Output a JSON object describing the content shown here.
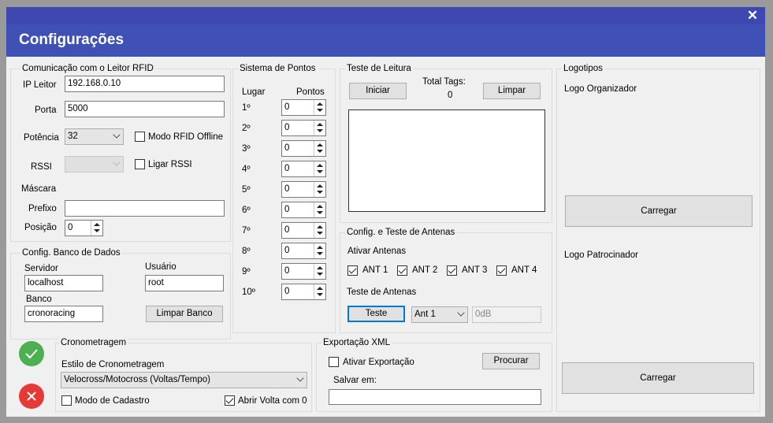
{
  "window": {
    "close_glyph": "✕",
    "title": "Configurações"
  },
  "rfid": {
    "title": "Comunicação com o Leitor RFID",
    "ip_label": "IP Leitor",
    "ip_value": "192.168.0.10",
    "porta_label": "Porta",
    "porta_value": "5000",
    "potencia_label": "Potência",
    "potencia_value": "32",
    "offline_label": "Modo RFID Offline",
    "rssi_label": "RSSI",
    "ligar_rssi_label": "Ligar RSSI",
    "mascara_label": "Máscara",
    "prefixo_label": "Prefixo",
    "prefixo_value": "",
    "posicao_label": "Posição",
    "posicao_value": "0"
  },
  "banco": {
    "title": "Config. Banco de Dados",
    "servidor_label": "Servidor",
    "servidor_value": "localhost",
    "usuario_label": "Usuário",
    "usuario_value": "root",
    "banco_label": "Banco",
    "banco_value": "cronoracing",
    "limpar_label": "Limpar Banco"
  },
  "pontos": {
    "title": "Sistema de Pontos",
    "lugar_header": "Lugar",
    "pontos_header": "Pontos",
    "rows": [
      {
        "place": "1º",
        "value": "0"
      },
      {
        "place": "2º",
        "value": "0"
      },
      {
        "place": "3º",
        "value": "0"
      },
      {
        "place": "4º",
        "value": "0"
      },
      {
        "place": "5º",
        "value": "0"
      },
      {
        "place": "6º",
        "value": "0"
      },
      {
        "place": "7º",
        "value": "0"
      },
      {
        "place": "8º",
        "value": "0"
      },
      {
        "place": "9º",
        "value": "0"
      },
      {
        "place": "10º",
        "value": "0"
      }
    ]
  },
  "leitura": {
    "title": "Teste de Leitura",
    "iniciar_label": "Iniciar",
    "total_tags_label": "Total Tags:",
    "total_tags_value": "0",
    "limpar_label": "Limpar"
  },
  "antenas": {
    "title": "Config. e Teste de Antenas",
    "ativar_label": "Ativar Antenas",
    "items": [
      {
        "label": "ANT 1",
        "checked": true
      },
      {
        "label": "ANT 2",
        "checked": true
      },
      {
        "label": "ANT 3",
        "checked": true
      },
      {
        "label": "ANT 4",
        "checked": true
      }
    ],
    "teste_label": "Teste de Antenas",
    "teste_button": "Teste",
    "ant_select": "Ant 1",
    "db_value": "0dB"
  },
  "logotipos": {
    "title": "Logotipos",
    "organizador_label": "Logo Organizador",
    "carregar1": "Carregar",
    "patrocinador_label": "Logo Patrocinador",
    "carregar2": "Carregar"
  },
  "crono": {
    "title": "Cronometragem",
    "estilo_label": "Estilo de Cronometragem",
    "estilo_value": "Velocross/Motocross (Voltas/Tempo)",
    "cadastro_label": "Modo de Cadastro",
    "abrir_label": "Abrir Volta com 0"
  },
  "xml": {
    "title": "Exportação XML",
    "ativar_label": "Ativar Exportação",
    "procurar_label": "Procurar",
    "salvar_label": "Salvar em:",
    "salvar_value": ""
  },
  "actions": {
    "ok_color": "#4caf50",
    "cancel_color": "#e53935"
  },
  "colors": {
    "title_bar": "#3f48b0",
    "header": "#3f51b5",
    "focus": "#0078d7"
  }
}
